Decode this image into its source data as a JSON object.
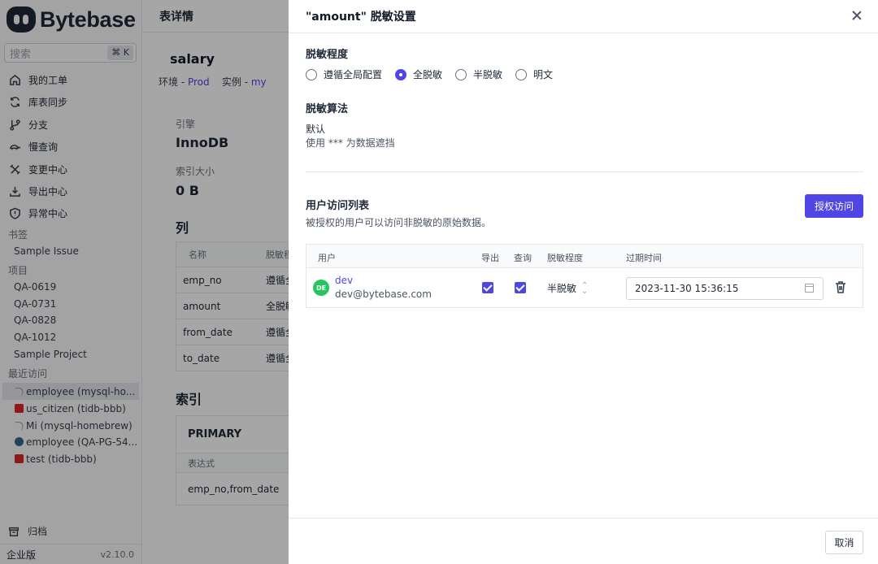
{
  "sidebar": {
    "brand": "Bytebase",
    "search": {
      "placeholder": "搜索",
      "shortcut": "⌘ K"
    },
    "nav": [
      {
        "label": "我的工单",
        "icon": "home-icon"
      },
      {
        "label": "库表同步",
        "icon": "sync-icon"
      },
      {
        "label": "分支",
        "icon": "branch-icon"
      },
      {
        "label": "慢查询",
        "icon": "turtle-icon"
      },
      {
        "label": "变更中心",
        "icon": "tools-icon"
      },
      {
        "label": "导出中心",
        "icon": "download-icon"
      },
      {
        "label": "异常中心",
        "icon": "shield-alert-icon"
      }
    ],
    "bookmarks_title": "书签",
    "bookmarks": [
      "Sample Issue"
    ],
    "projects_title": "项目",
    "projects": [
      "QA-0619",
      "QA-0731",
      "QA-0828",
      "QA-1012",
      "Sample Project"
    ],
    "recent_title": "最近访问",
    "recent": [
      {
        "label": "employee (mysql-ho...",
        "icon": "mysql-icon"
      },
      {
        "label": "us_citizen (tidb-bbb)",
        "icon": "tidb-icon"
      },
      {
        "label": "Mi (mysql-homebrew)",
        "icon": "mysql-icon"
      },
      {
        "label": "employee (QA-PG-54...",
        "icon": "postgres-icon"
      },
      {
        "label": "test (tidb-bbb)",
        "icon": "tidb-icon"
      }
    ],
    "archive": "归档",
    "plan": "企业版",
    "version": "v2.10.0"
  },
  "main": {
    "header": "表详情",
    "table_name": "salary",
    "env_label": "环境 - ",
    "env_value": "Prod",
    "instance_label": "实例 - ",
    "instance_value": "my",
    "engine_label": "引擎",
    "engine_value": "InnoDB",
    "index_size_label": "索引大小",
    "index_size_value": "0 B",
    "columns_title": "列",
    "columns_headers": [
      "名称",
      "脱敏程"
    ],
    "columns": [
      {
        "name": "emp_no",
        "level": "遵循全"
      },
      {
        "name": "amount",
        "level": "全脱敏"
      },
      {
        "name": "from_date",
        "level": "遵循全"
      },
      {
        "name": "to_date",
        "level": "遵循全"
      }
    ],
    "indexes_title": "索引",
    "index_name": "PRIMARY",
    "index_expr_label": "表达式",
    "index_expr": "emp_no,from_date"
  },
  "drawer": {
    "title": "\"amount\" 脱敏设置",
    "level_title": "脱敏程度",
    "level_options": [
      "遵循全局配置",
      "全脱敏",
      "半脱敏",
      "明文"
    ],
    "level_selected": "全脱敏",
    "algo_title": "脱敏算法",
    "algo_name": "默认",
    "algo_desc": "使用 *** 为数据遮挡",
    "access_title": "用户访问列表",
    "access_desc": "被授权的用户可以访问非脱敏的原始数据。",
    "grant_button": "授权访问",
    "table_headers": [
      "用户",
      "导出",
      "查询",
      "脱敏程度",
      "过期时间"
    ],
    "rows": [
      {
        "avatar": "DE",
        "name": "dev",
        "email": "dev@bytebase.com",
        "export": true,
        "query": true,
        "level": "半脱敏",
        "expire": "2023-11-30 15:36:15"
      }
    ],
    "cancel_button": "取消"
  },
  "colors": {
    "accent": "#4f46e5",
    "avatar": "#22c55e",
    "overlay": "rgba(0,0,0,0.35)"
  }
}
